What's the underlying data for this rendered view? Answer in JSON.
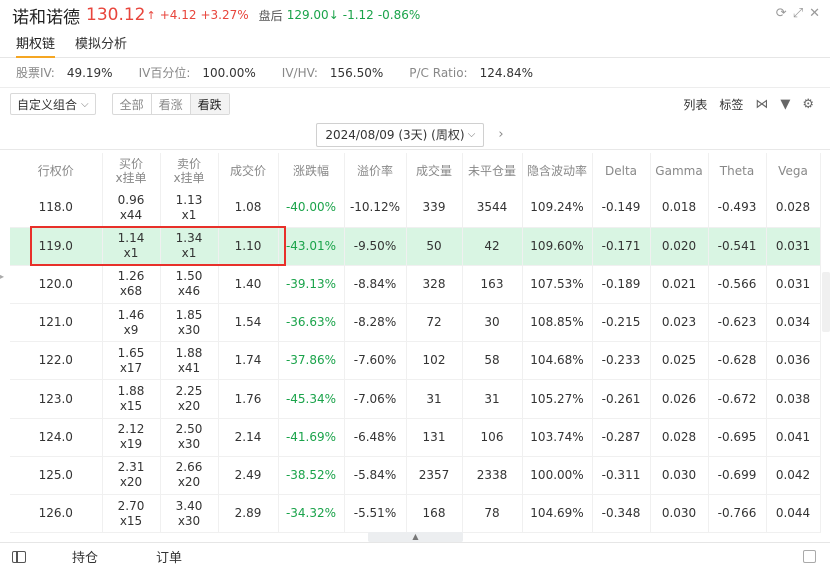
{
  "header": {
    "stock_name": "诺和诺德",
    "price": "130.12",
    "arrow": "↑",
    "change": "+4.12",
    "change_pct": "+3.27%",
    "after_hours_label": "盘后",
    "after_hours_price": "129.00",
    "after_hours_arrow": "↓",
    "after_hours_change": "-1.12",
    "after_hours_pct": "-0.86%",
    "icons": [
      "refresh-icon",
      "expand-icon",
      "close-icon"
    ]
  },
  "tabs": [
    {
      "label": "期权链",
      "active": true
    },
    {
      "label": "模拟分析",
      "active": false
    }
  ],
  "stats": [
    {
      "label": "股票IV:",
      "value": "49.19%"
    },
    {
      "label": "IV百分位:",
      "value": "100.00%"
    },
    {
      "label": "IV/HV:",
      "value": "156.50%"
    },
    {
      "label": "P/C Ratio:",
      "value": "124.84%"
    }
  ],
  "toolbar": {
    "combo_label": "自定义组合",
    "filters": [
      "全部",
      "看涨",
      "看跌"
    ],
    "list_label": "列表",
    "tag_label": "标签"
  },
  "expiry": {
    "label": "2024/08/09 (3天) (周权)"
  },
  "table": {
    "headers": [
      {
        "line1": "行权价",
        "line2": ""
      },
      {
        "line1": "买价",
        "line2": "x挂单"
      },
      {
        "line1": "卖价",
        "line2": "x挂单"
      },
      {
        "line1": "成交价",
        "line2": ""
      },
      {
        "line1": "涨跌幅",
        "line2": ""
      },
      {
        "line1": "溢价率",
        "line2": ""
      },
      {
        "line1": "成交量",
        "line2": ""
      },
      {
        "line1": "未平仓量",
        "line2": ""
      },
      {
        "line1": "隐含波动率",
        "line2": ""
      },
      {
        "line1": "Delta",
        "line2": ""
      },
      {
        "line1": "Gamma",
        "line2": ""
      },
      {
        "line1": "Theta",
        "line2": ""
      },
      {
        "line1": "Vega",
        "line2": ""
      }
    ],
    "rows": [
      {
        "strike": "118.0",
        "bid": "0.96",
        "bid_size": "x44",
        "ask": "1.13",
        "ask_size": "x1",
        "last": "1.08",
        "chg": "-40.00%",
        "premium": "-10.12%",
        "volume": "339",
        "oi": "3544",
        "iv": "109.24%",
        "delta": "-0.149",
        "gamma": "0.018",
        "theta": "-0.493",
        "vega": "0.028"
      },
      {
        "strike": "119.0",
        "bid": "1.14",
        "bid_size": "x1",
        "ask": "1.34",
        "ask_size": "x1",
        "last": "1.10",
        "chg": "-43.01%",
        "premium": "-9.50%",
        "volume": "50",
        "oi": "42",
        "iv": "109.60%",
        "delta": "-0.171",
        "gamma": "0.020",
        "theta": "-0.541",
        "vega": "0.031"
      },
      {
        "strike": "120.0",
        "bid": "1.26",
        "bid_size": "x68",
        "ask": "1.50",
        "ask_size": "x46",
        "last": "1.40",
        "chg": "-39.13%",
        "premium": "-8.84%",
        "volume": "328",
        "oi": "163",
        "iv": "107.53%",
        "delta": "-0.189",
        "gamma": "0.021",
        "theta": "-0.566",
        "vega": "0.031"
      },
      {
        "strike": "121.0",
        "bid": "1.46",
        "bid_size": "x9",
        "ask": "1.85",
        "ask_size": "x30",
        "last": "1.54",
        "chg": "-36.63%",
        "premium": "-8.28%",
        "volume": "72",
        "oi": "30",
        "iv": "108.85%",
        "delta": "-0.215",
        "gamma": "0.023",
        "theta": "-0.623",
        "vega": "0.034"
      },
      {
        "strike": "122.0",
        "bid": "1.65",
        "bid_size": "x17",
        "ask": "1.88",
        "ask_size": "x41",
        "last": "1.74",
        "chg": "-37.86%",
        "premium": "-7.60%",
        "volume": "102",
        "oi": "58",
        "iv": "104.68%",
        "delta": "-0.233",
        "gamma": "0.025",
        "theta": "-0.628",
        "vega": "0.036"
      },
      {
        "strike": "123.0",
        "bid": "1.88",
        "bid_size": "x15",
        "ask": "2.25",
        "ask_size": "x20",
        "last": "1.76",
        "chg": "-45.34%",
        "premium": "-7.06%",
        "volume": "31",
        "oi": "31",
        "iv": "105.27%",
        "delta": "-0.261",
        "gamma": "0.026",
        "theta": "-0.672",
        "vega": "0.038"
      },
      {
        "strike": "124.0",
        "bid": "2.12",
        "bid_size": "x19",
        "ask": "2.50",
        "ask_size": "x30",
        "last": "2.14",
        "chg": "-41.69%",
        "premium": "-6.48%",
        "volume": "131",
        "oi": "106",
        "iv": "103.74%",
        "delta": "-0.287",
        "gamma": "0.028",
        "theta": "-0.695",
        "vega": "0.041"
      },
      {
        "strike": "125.0",
        "bid": "2.31",
        "bid_size": "x20",
        "ask": "2.66",
        "ask_size": "x20",
        "last": "2.49",
        "chg": "-38.52%",
        "premium": "-5.84%",
        "volume": "2357",
        "oi": "2338",
        "iv": "100.00%",
        "delta": "-0.311",
        "gamma": "0.030",
        "theta": "-0.699",
        "vega": "0.042"
      },
      {
        "strike": "126.0",
        "bid": "2.70",
        "bid_size": "x15",
        "ask": "3.40",
        "ask_size": "x30",
        "last": "2.89",
        "chg": "-34.32%",
        "premium": "-5.51%",
        "volume": "168",
        "oi": "78",
        "iv": "104.69%",
        "delta": "-0.348",
        "gamma": "0.030",
        "theta": "-0.766",
        "vega": "0.044"
      }
    ]
  },
  "bottom": {
    "holdings": "持仓",
    "orders": "订单"
  },
  "colors": {
    "up": "#e8453c",
    "down": "#1aa34a",
    "highlight": "#d9f5e3",
    "accent": "#f5a623",
    "box": "#e8302a"
  }
}
